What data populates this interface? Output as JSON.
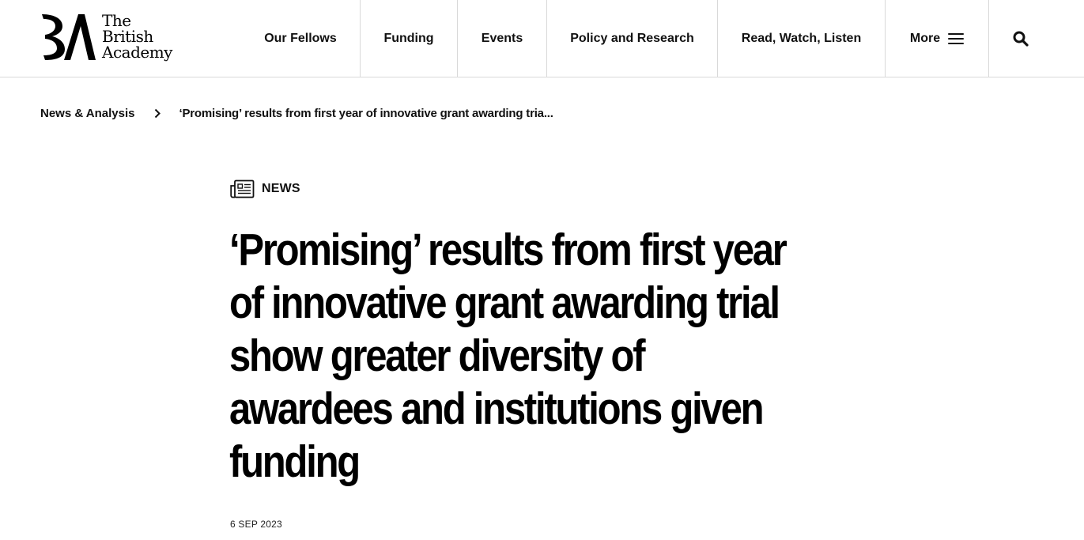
{
  "site": {
    "logo_lines": [
      "The",
      "British",
      "Academy"
    ]
  },
  "nav": {
    "items": [
      "Our Fellows",
      "Funding",
      "Events",
      "Policy and Research",
      "Read, Watch, Listen"
    ],
    "more_label": "More"
  },
  "breadcrumb": {
    "parent": "News & Analysis",
    "current": "‘Promising’ results from first year of innovative grant awarding tria..."
  },
  "article": {
    "tag": "NEWS",
    "headline_lines": [
      "‘Promising’ results from first year",
      "of innovative grant awarding trial",
      "show greater diversity of",
      "awardees and institutions given",
      "funding"
    ],
    "date": "6 SEP 2023"
  },
  "icons": {
    "menu": "hamburger-icon",
    "search": "search-icon",
    "breadcrumb_separator": "chevron-right-icon",
    "tag": "newspaper-icon"
  },
  "colors": {
    "text": "#000000",
    "divider": "#d9d9d9",
    "background": "#ffffff"
  }
}
